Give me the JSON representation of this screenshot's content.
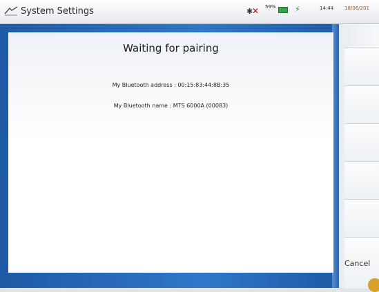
{
  "window": {
    "title": "System Settings",
    "status": {
      "battery_percent": "59%",
      "time": "14:44",
      "date": "18/06/201"
    }
  },
  "dialog": {
    "title": "Waiting for pairing",
    "bluetooth_address_label": "My Bluetooth address : 00:15:83:44:8B:35",
    "bluetooth_name_label": "My Bluetooth name : MTS 6000A (00083)"
  },
  "side_panel": {
    "cancel_label": "Cancel"
  },
  "colors": {
    "frame_blue": "#2f77c8",
    "battery_green": "#39a34a"
  }
}
